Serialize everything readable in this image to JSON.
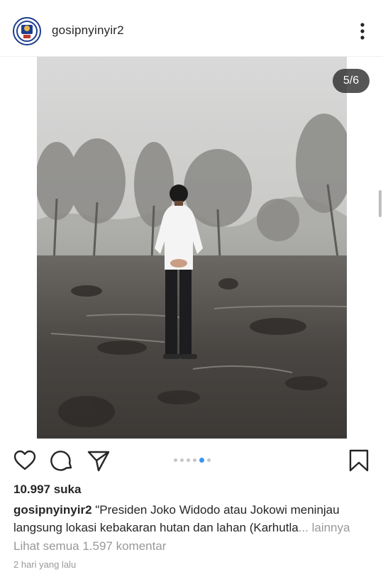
{
  "post": {
    "username": "gosipnyinyir2",
    "counter": "5/6",
    "carousel": {
      "total": 6,
      "active_index": 5
    },
    "likes": "10.997 suka",
    "caption": {
      "username": "gosipnyinyir2",
      "line1": " \"Presiden Joko Widodo atau Jokowi meninjau",
      "line2": "langsung lokasi kebakaran hutan dan lahan (Karhutla",
      "ellipsis": "...",
      "more_label": "lainnya"
    },
    "view_comments": "Lihat semua 1.597 komentar",
    "timestamp": "2 hari yang lalu"
  },
  "icons": {
    "more": "more-vertical-icon",
    "like": "heart-icon",
    "comment": "comment-icon",
    "share": "send-icon",
    "save": "bookmark-icon"
  },
  "colors": {
    "accent": "#3897f0",
    "text": "#262626",
    "muted": "#999999",
    "avatar_ring": "#1d3d8f"
  }
}
